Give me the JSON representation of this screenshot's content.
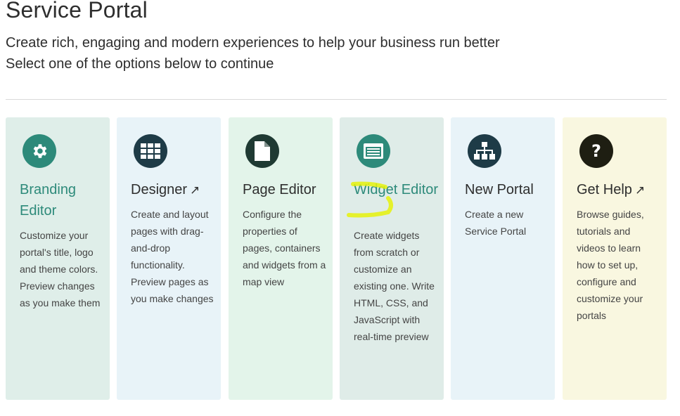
{
  "header": {
    "title": "Service Portal",
    "subtitle_line1": "Create rich, engaging and modern experiences to help your business run better",
    "subtitle_line2": "Select one of the options below to continue"
  },
  "cards": [
    {
      "title": "Branding Editor",
      "description": "Customize your portal's title, logo and theme colors. Preview changes as you make them",
      "icon": "gear-icon",
      "bg": "#dfeee9",
      "icon_bg": "#2d8a7a"
    },
    {
      "title": "Designer",
      "external_marker": "↗",
      "description": "Create and layout pages with drag-and-drop functionality. Preview pages as you make changes",
      "icon": "grid-icon",
      "bg": "#e8f3f8",
      "icon_bg": "#1e3b47"
    },
    {
      "title": "Page Editor",
      "description": "Configure the properties of pages, containers and widgets from a map view",
      "icon": "document-icon",
      "bg": "#e3f4ea",
      "icon_bg": "#1f3a33"
    },
    {
      "title": "Widget Editor",
      "description": "Create widgets from scratch or customize an existing one. Write HTML, CSS, and JavaScript with real-time preview",
      "icon": "widget-window-icon",
      "bg": "#dfece8",
      "icon_bg": "#2d8a7a"
    },
    {
      "title": "New Portal",
      "description": "Create a new Service Portal",
      "icon": "sitemap-icon",
      "bg": "#e8f3f8",
      "icon_bg": "#1e3b47"
    },
    {
      "title": "Get Help",
      "external_marker": "↗",
      "description": "Browse guides, tutorials and videos to learn how to set up, configure and customize your portals",
      "icon": "question-icon",
      "bg": "#f9f7e0",
      "icon_bg": "#1e1e12"
    }
  ],
  "annotation": {
    "highlight_color": "#e6f20a"
  }
}
